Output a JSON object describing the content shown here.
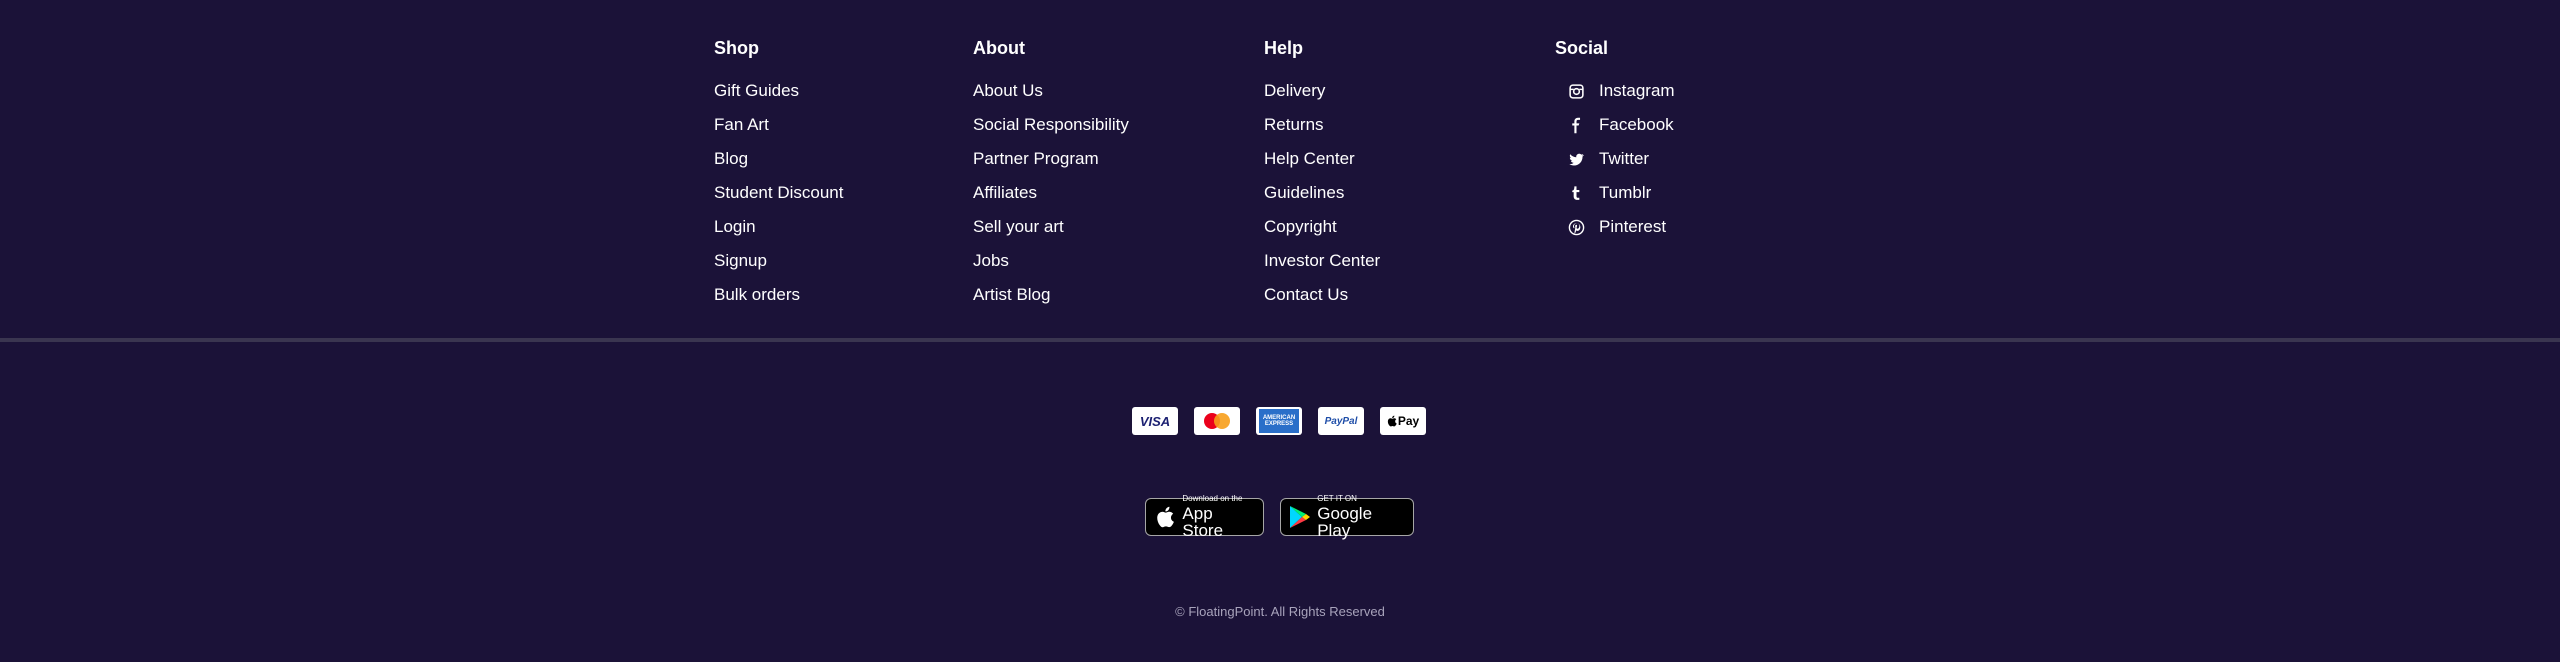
{
  "footer": {
    "columns": [
      {
        "heading": "Shop",
        "items": [
          "Gift Guides",
          "Fan Art",
          "Blog",
          "Student Discount",
          "Login",
          "Signup",
          "Bulk orders"
        ]
      },
      {
        "heading": "About",
        "items": [
          "About Us",
          "Social Responsibility",
          "Partner Program",
          "Affiliates",
          "Sell your art",
          "Jobs",
          "Artist Blog"
        ]
      },
      {
        "heading": "Help",
        "items": [
          "Delivery",
          "Returns",
          "Help Center",
          "Guidelines",
          "Copyright",
          "Investor Center",
          "Contact Us"
        ]
      }
    ],
    "social": {
      "heading": "Social",
      "items": [
        {
          "label": "Instagram",
          "icon": "instagram-icon"
        },
        {
          "label": "Facebook",
          "icon": "facebook-icon"
        },
        {
          "label": "Twitter",
          "icon": "twitter-icon"
        },
        {
          "label": "Tumblr",
          "icon": "tumblr-icon"
        },
        {
          "label": "Pinterest",
          "icon": "pinterest-icon"
        }
      ]
    },
    "payments": {
      "visa": "VISA",
      "amex": "AMERICAN EXPRESS",
      "paypal": "PayPal",
      "applepay": "Pay"
    },
    "apps": {
      "appstore_small": "Download on the",
      "appstore_big": "App Store",
      "googleplay_small": "GET IT ON",
      "googleplay_big": "Google Play"
    },
    "copyright": "© FloatingPoint. All Rights Reserved"
  },
  "colors": {
    "background": "#1b1238",
    "divider": "#3a3550",
    "text": "#ffffff",
    "muted": "#a8a3bb"
  }
}
